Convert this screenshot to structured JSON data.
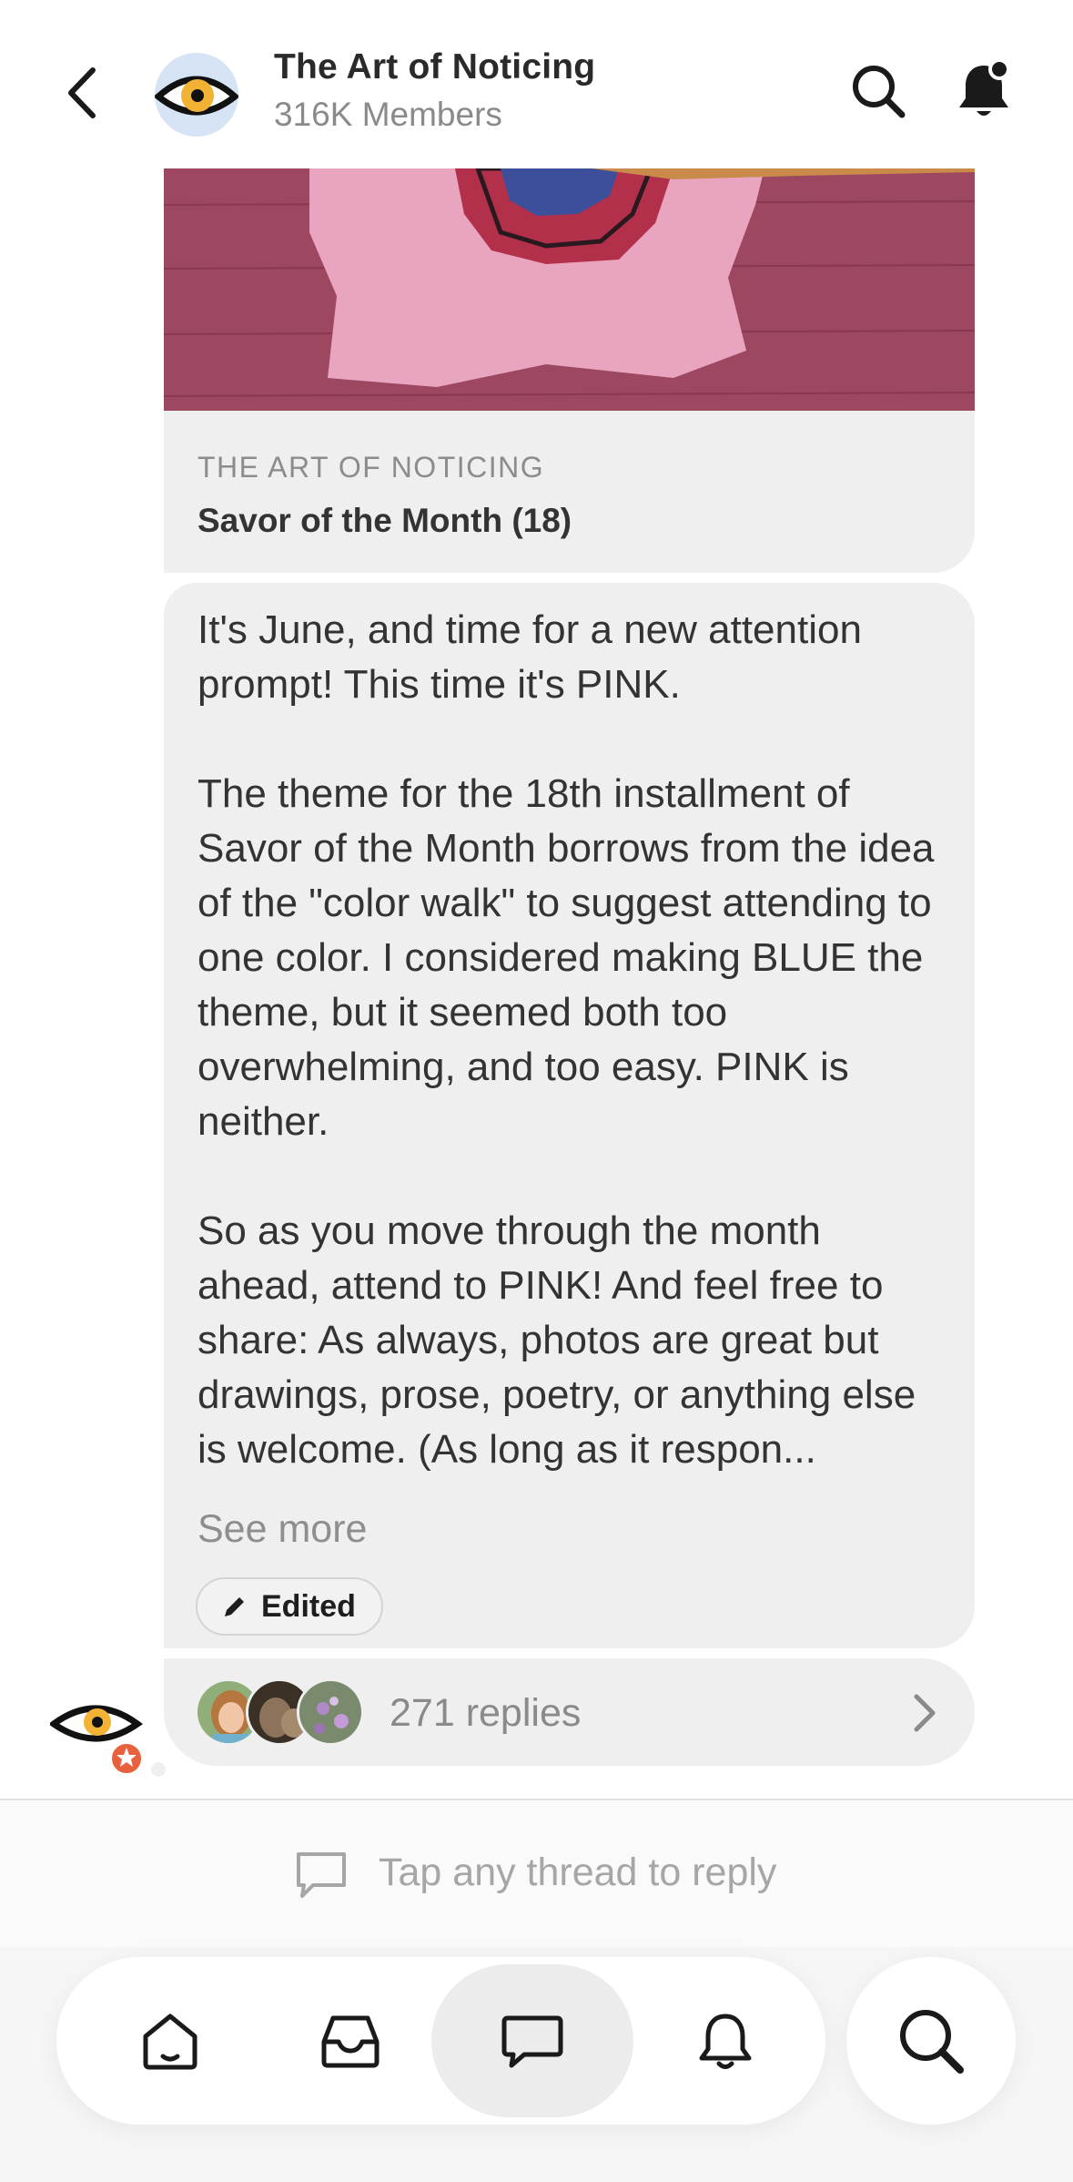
{
  "header": {
    "title": "The Art of Noticing",
    "members": "316K Members"
  },
  "link_card": {
    "source": "THE ART OF NOTICING",
    "title": "Savor of the Month (18)"
  },
  "message": {
    "paragraphs": [
      "It's June, and time for a new attention prompt! This time it's PINK.",
      "The theme for the 18th installment of Savor of the Month borrows from the idea of the \"color walk\" to suggest attending to one color. I considered making BLUE the theme, but it seemed both too overwhelming, and too easy. PINK is neither.",
      "So as you move through the month ahead, attend to PINK! And feel free to share: As always, photos are great but drawings, prose, poetry, or anything else is welcome. (As long as it respon..."
    ],
    "see_more": "See more",
    "edited_label": "Edited"
  },
  "replies": {
    "count_label": "271 replies"
  },
  "reply_hint": {
    "text": "Tap any thread to reply"
  },
  "nav": {
    "tabs": [
      "home-icon",
      "inbox-icon",
      "chat-icon",
      "bell-icon"
    ],
    "active_tab": "chat-icon",
    "search": "search-icon"
  },
  "colors": {
    "bubble": "#efefef",
    "eye_iris": "#f2b234",
    "badge": "#e8603c"
  }
}
